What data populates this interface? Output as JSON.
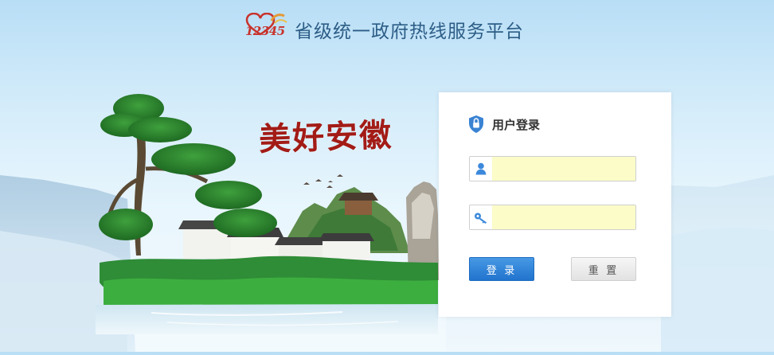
{
  "header": {
    "logo_text": "12345",
    "title": "省级统一政府热线服务平台"
  },
  "banner": {
    "slogan": "美好安徽"
  },
  "login": {
    "title": "用户登录",
    "username": {
      "value": "",
      "placeholder": ""
    },
    "password": {
      "value": "",
      "placeholder": ""
    },
    "login_button": "登 录",
    "reset_button": "重 置"
  },
  "icons": {
    "logo": "12345-heart-logo",
    "shield": "lock-shield-icon",
    "user": "user-icon",
    "key": "key-icon"
  },
  "colors": {
    "accent": "#2c7be5",
    "brand_red": "#c8332c",
    "title_blue": "#2c5d86",
    "input_fill": "#fbfcc8"
  }
}
